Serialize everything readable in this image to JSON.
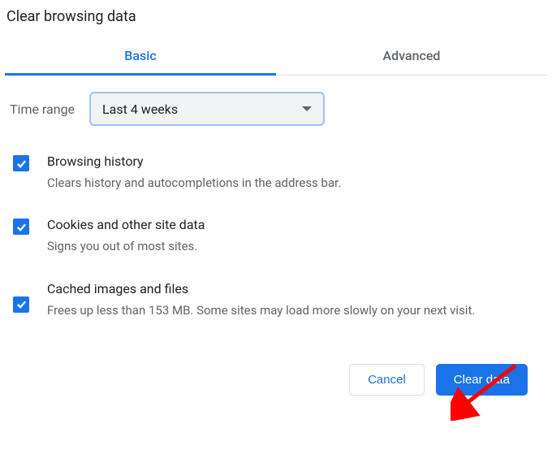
{
  "title": "Clear browsing data",
  "tabs": {
    "basic": "Basic",
    "advanced": "Advanced"
  },
  "timeRange": {
    "label": "Time range",
    "value": "Last 4 weeks"
  },
  "options": {
    "history": {
      "title": "Browsing history",
      "desc": "Clears history and autocompletions in the address bar."
    },
    "cookies": {
      "title": "Cookies and other site data",
      "desc": "Signs you out of most sites."
    },
    "cache": {
      "title": "Cached images and files",
      "desc": "Frees up less than 153 MB. Some sites may load more slowly on your next visit."
    }
  },
  "buttons": {
    "cancel": "Cancel",
    "clear": "Clear data"
  }
}
